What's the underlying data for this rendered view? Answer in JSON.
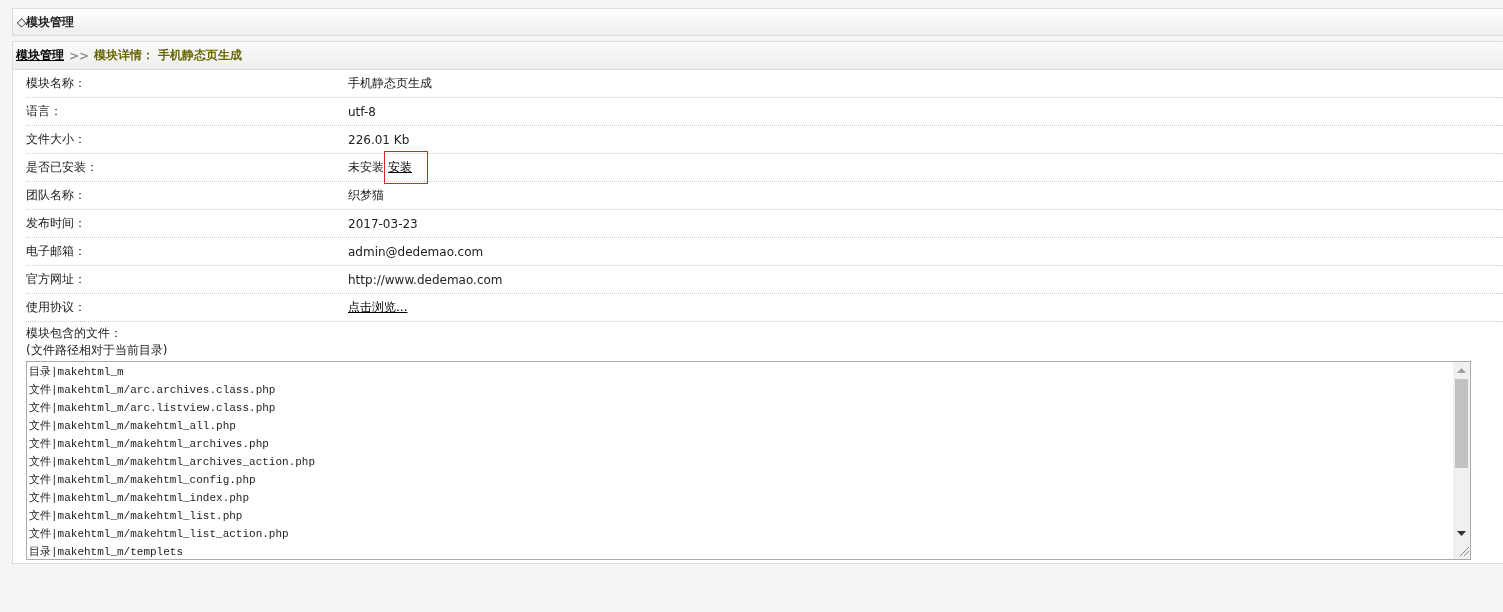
{
  "top_bar": {
    "title": "◇模块管理"
  },
  "breadcrumb": {
    "link": "模块管理",
    "separator": ">>",
    "current": "模块详情： 手机静态页生成"
  },
  "rows": [
    {
      "label": "模块名称：",
      "value": "手机静态页生成",
      "kind": "text"
    },
    {
      "label": "语言：",
      "value": "utf-8",
      "kind": "text"
    },
    {
      "label": "文件大小：",
      "value": "226.01 Kb",
      "kind": "text"
    },
    {
      "label": "是否已安装：",
      "value": "未安装",
      "action": "安装",
      "kind": "install"
    },
    {
      "label": "团队名称：",
      "value": "织梦猫",
      "kind": "text"
    },
    {
      "label": "发布时间：",
      "value": "2017-03-23",
      "kind": "text"
    },
    {
      "label": "电子邮箱：",
      "value": "admin@dedemao.com",
      "kind": "text"
    },
    {
      "label": "官方网址：",
      "value": "http://www.dedemao.com",
      "kind": "text"
    },
    {
      "label": "使用协议：",
      "value": "点击浏览...",
      "kind": "link"
    }
  ],
  "files": {
    "label": "模块包含的文件：",
    "note": "(文件路径相对于当前目录)",
    "lines": [
      "目录|makehtml_m",
      "文件|makehtml_m/arc.archives.class.php",
      "文件|makehtml_m/arc.listview.class.php",
      "文件|makehtml_m/makehtml_all.php",
      "文件|makehtml_m/makehtml_archives.php",
      "文件|makehtml_m/makehtml_archives_action.php",
      "文件|makehtml_m/makehtml_config.php",
      "文件|makehtml_m/makehtml_index.php",
      "文件|makehtml_m/makehtml_list.php",
      "文件|makehtml_m/makehtml_list_action.php",
      "目录|makehtml_m/templets"
    ]
  }
}
